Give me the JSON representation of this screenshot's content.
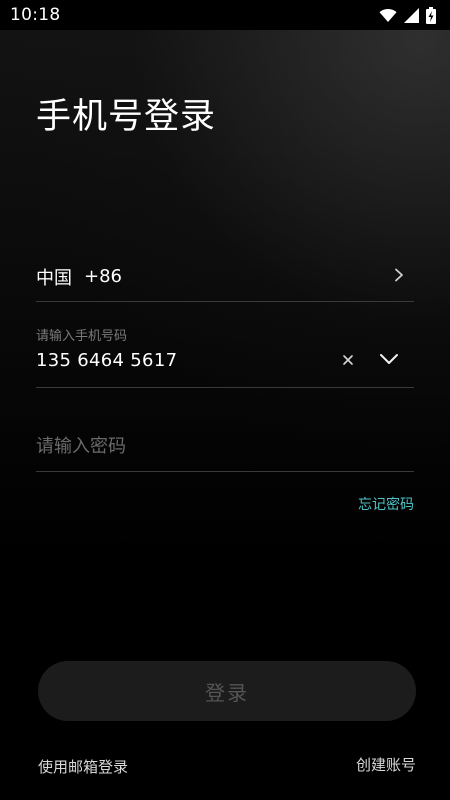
{
  "status_bar": {
    "time": "10:18",
    "icons": [
      "wifi-icon",
      "cellular-signal-icon",
      "battery-charging-icon"
    ]
  },
  "page": {
    "title": "手机号登录"
  },
  "country": {
    "name": "中国",
    "code": "+86",
    "icon": "chevron-right-icon"
  },
  "phone": {
    "label": "请输入手机号码",
    "value": "135 6464 5617",
    "clear_icon": "close-icon",
    "dropdown_icon": "chevron-down-icon"
  },
  "password": {
    "placeholder": "请输入密码",
    "value": ""
  },
  "forgot_password": "忘记密码",
  "login_button": "登录",
  "email_login": "使用邮箱登录",
  "create_account": "创建账号",
  "colors": {
    "accent": "#4fc3c8",
    "background": "#000000",
    "button_bg": "#1c1c1c",
    "button_text": "#555555"
  }
}
